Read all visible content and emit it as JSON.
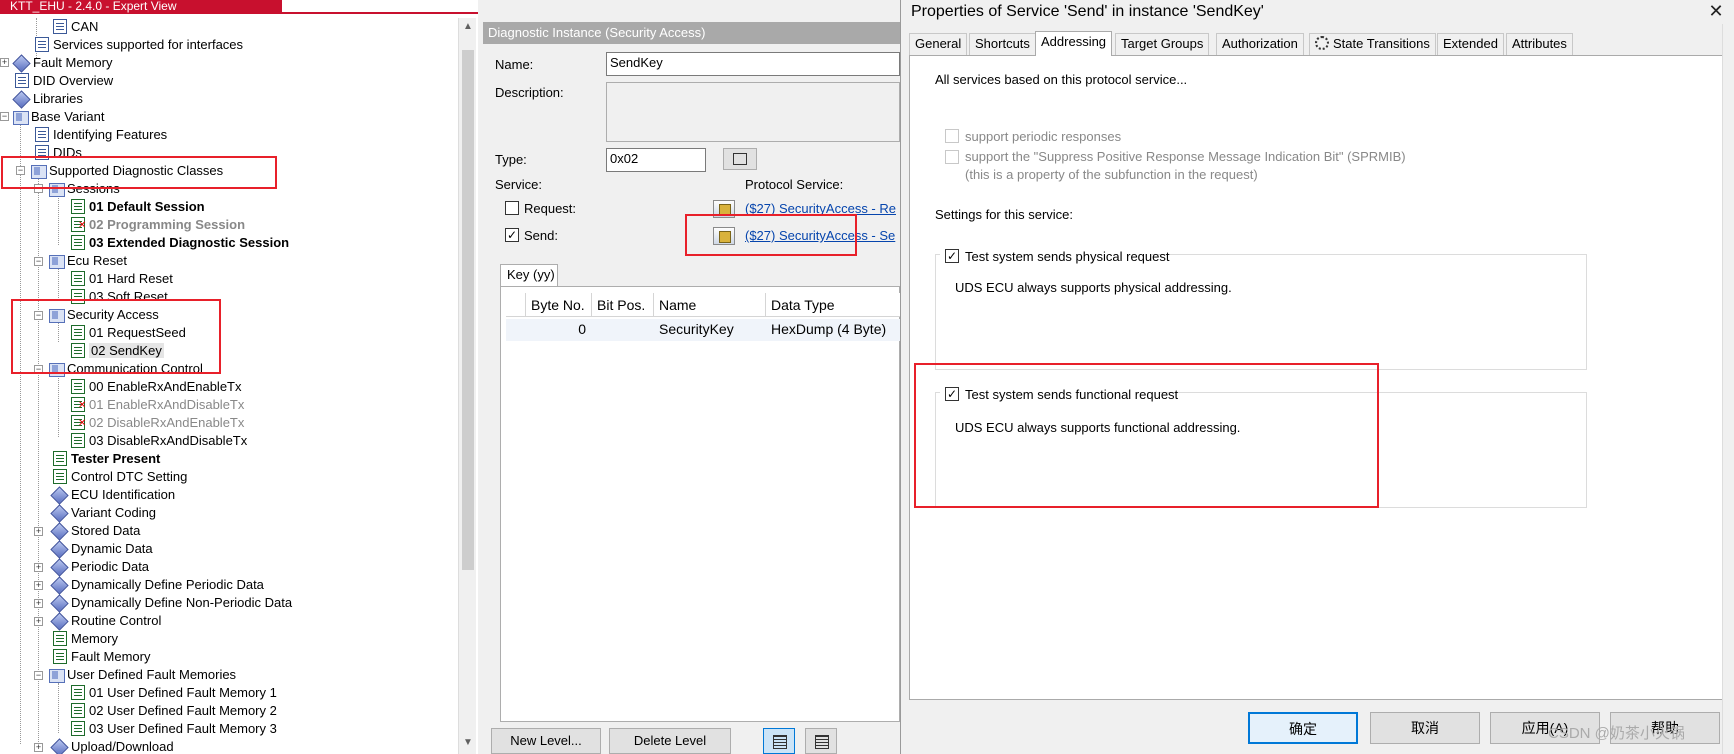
{
  "tree": {
    "title_strip": "KTT_EHU - 2.4.0 - Expert View",
    "items": [
      {
        "label": "CAN"
      },
      {
        "label": "Services supported for interfaces"
      },
      {
        "label": "Fault Memory"
      },
      {
        "label": "DID Overview"
      },
      {
        "label": "Libraries"
      },
      {
        "label": "Base Variant"
      },
      {
        "label": "Identifying Features"
      },
      {
        "label": "DIDs"
      },
      {
        "label": "Supported Diagnostic Classes"
      },
      {
        "label": "Sessions"
      },
      {
        "label": "01 Default Session"
      },
      {
        "label": "02 Programming Session"
      },
      {
        "label": "03 Extended Diagnostic Session"
      },
      {
        "label": "Ecu Reset"
      },
      {
        "label": "01 Hard Reset"
      },
      {
        "label": "03 Soft Reset"
      },
      {
        "label": "Security Access"
      },
      {
        "label": "01 RequestSeed"
      },
      {
        "label": "02 SendKey"
      },
      {
        "label": "Communication Control"
      },
      {
        "label": "00 EnableRxAndEnableTx"
      },
      {
        "label": "01 EnableRxAndDisableTx"
      },
      {
        "label": "02 DisableRxAndEnableTx"
      },
      {
        "label": "03 DisableRxAndDisableTx"
      },
      {
        "label": "Tester Present"
      },
      {
        "label": "Control DTC Setting"
      },
      {
        "label": "ECU Identification"
      },
      {
        "label": "Variant Coding"
      },
      {
        "label": "Stored Data"
      },
      {
        "label": "Dynamic Data"
      },
      {
        "label": "Periodic Data"
      },
      {
        "label": "Dynamically Define Periodic Data"
      },
      {
        "label": "Dynamically Define Non-Periodic Data"
      },
      {
        "label": "Routine Control"
      },
      {
        "label": "Memory"
      },
      {
        "label": "Fault Memory"
      },
      {
        "label": "User Defined Fault Memories"
      },
      {
        "label": "01 User Defined Fault Memory 1"
      },
      {
        "label": "02 User Defined Fault Memory 2"
      },
      {
        "label": "03 User Defined Fault Memory 3"
      },
      {
        "label": "Upload/Download"
      }
    ]
  },
  "instance": {
    "header": "Diagnostic Instance (Security Access)",
    "name_label": "Name:",
    "name_value": "SendKey",
    "description_label": "Description:",
    "type_label": "Type:",
    "type_value": "0x02",
    "service_label": "Service:",
    "protocol_service_label": "Protocol Service:",
    "request_label": "Request:",
    "send_label": "Send:",
    "request_link": "($27) SecurityAccess - Re",
    "send_link": "($27) SecurityAccess - Se",
    "send_checked": "✓",
    "key_tab": "Key (yy)",
    "grid": {
      "headers": [
        "Byte No.",
        "Bit Pos.",
        "Name",
        "Data Type"
      ],
      "rows": [
        {
          "byte": "0",
          "bit": "",
          "name": "SecurityKey",
          "type": "HexDump (4 Byte)"
        }
      ]
    },
    "new_level": "New Level...",
    "delete_level": "Delete Level"
  },
  "dialog": {
    "title": "Properties of Service 'Send' in instance 'SendKey'",
    "close": "✕",
    "tabs": [
      "General",
      "Shortcuts",
      "Addressing",
      "Target Groups",
      "Authorization",
      "State Transitions",
      "Extended",
      "Attributes"
    ],
    "intro": "All services based on this protocol service...",
    "periodic": "support periodic responses",
    "sprmib": "support the \"Suppress Positive Response Message Indication Bit\" (SPRMIB)",
    "sprmib_note": "(this is a property of the subfunction in the request)",
    "settings_label": "Settings for this service:",
    "physical_check": "Test system sends physical request",
    "physical_note": "UDS ECU always supports physical addressing.",
    "functional_check": "Test system sends functional request",
    "functional_note": "UDS ECU always supports functional addressing.",
    "checked": "✓",
    "ok": "确定",
    "cancel": "取消",
    "apply": "应用(A)",
    "help": "帮助"
  },
  "watermark": "CSDN @奶茶小火锅",
  "colors": {
    "highlight": "#e8202a",
    "link": "#0645ad",
    "title_strip": "#c8102e"
  }
}
